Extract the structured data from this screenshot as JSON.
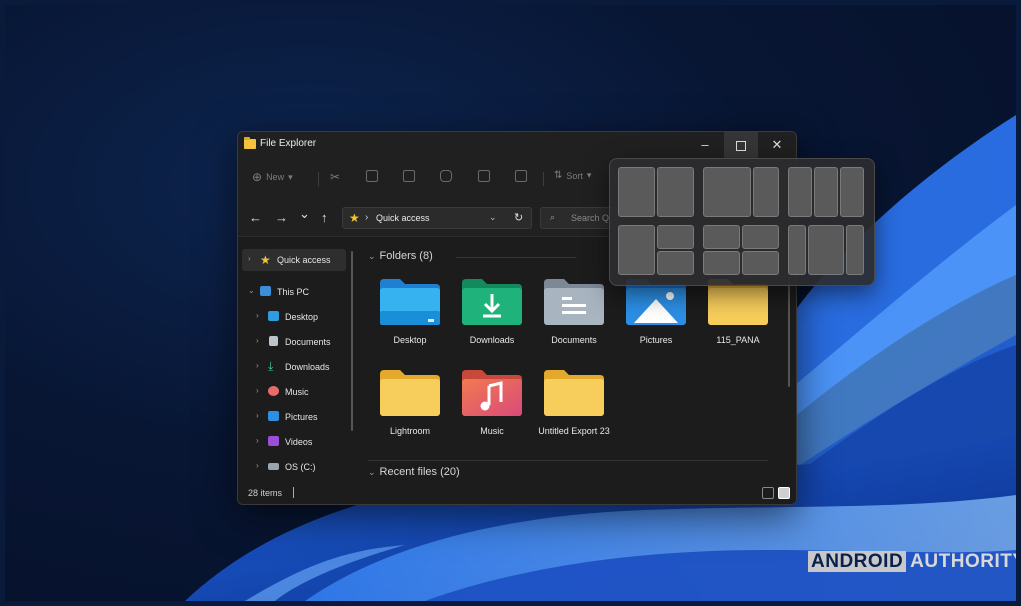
{
  "window": {
    "title": "File Explorer",
    "minimize": "–",
    "close": "✕"
  },
  "toolbar": {
    "new_label": "New",
    "sort_label": "Sort"
  },
  "navigation": {
    "back": "←",
    "forward": "→",
    "recent": "⌄",
    "up": "↑"
  },
  "address": {
    "path": "Quick access",
    "search_placeholder": "Search Q"
  },
  "sidebar": {
    "items": [
      {
        "label": "Quick access",
        "icon": "star-icon"
      },
      {
        "label": "This PC",
        "icon": "pc-icon"
      },
      {
        "label": "Desktop",
        "icon": "desktop-icon"
      },
      {
        "label": "Documents",
        "icon": "documents-icon"
      },
      {
        "label": "Downloads",
        "icon": "download-icon"
      },
      {
        "label": "Music",
        "icon": "music-icon"
      },
      {
        "label": "Pictures",
        "icon": "pictures-icon"
      },
      {
        "label": "Videos",
        "icon": "videos-icon"
      },
      {
        "label": "OS (C:)",
        "icon": "drive-icon"
      }
    ]
  },
  "content": {
    "folders_header": "Folders (8)",
    "recent_header": "Recent files (20)",
    "folders": [
      {
        "label": "Desktop",
        "icon": "desktop-folder-icon"
      },
      {
        "label": "Downloads",
        "icon": "downloads-folder-icon"
      },
      {
        "label": "Documents",
        "icon": "documents-folder-icon"
      },
      {
        "label": "Pictures",
        "icon": "pictures-folder-icon"
      },
      {
        "label": "115_PANA",
        "icon": "folder-icon"
      },
      {
        "label": "Lightroom",
        "icon": "folder-icon"
      },
      {
        "label": "Music",
        "icon": "music-folder-icon"
      },
      {
        "label": "Untitled Export 23",
        "icon": "folder-icon"
      }
    ]
  },
  "status": {
    "items_count": "28 items"
  },
  "watermark": {
    "part1": "ANDROID",
    "part2": "AUTHORITY"
  },
  "colors": {
    "accent": "#4cc2ff",
    "folder_yellow": "#f4c64f",
    "window_bg": "#1c1c1c"
  }
}
